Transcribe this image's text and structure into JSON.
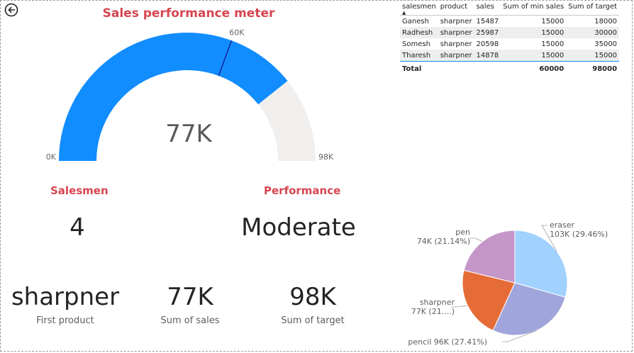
{
  "gauge": {
    "title": "Sales performance meter",
    "value": 77000,
    "value_label": "77K",
    "min": 0,
    "min_label": "0K",
    "max": 98000,
    "max_label": "98K",
    "target": 60000,
    "target_label": "60K",
    "fill_color": "#118dff",
    "track_color": "#f0efee",
    "target_color": "#12239e"
  },
  "cards": {
    "salesmen_title": "Salesmen",
    "salesmen_value": "4",
    "performance_title": "Performance",
    "performance_value": "Moderate",
    "first_product_value": "sharpner",
    "first_product_label": "First product",
    "sum_sales_value": "77K",
    "sum_sales_label": "Sum of sales",
    "sum_target_value": "98K",
    "sum_target_label": "Sum of target"
  },
  "table": {
    "headers": [
      "salesmen",
      "product",
      "sales",
      "Sum of min sales",
      "Sum of target"
    ],
    "rows": [
      [
        "Ganesh",
        "sharpner",
        "15487",
        "15000",
        "18000"
      ],
      [
        "Radhesh",
        "sharpner",
        "25987",
        "15000",
        "30000"
      ],
      [
        "Somesh",
        "sharpner",
        "20598",
        "15000",
        "35000"
      ],
      [
        "Tharesh",
        "sharpner",
        "14878",
        "15000",
        "15000"
      ]
    ],
    "total": [
      "Total",
      "",
      "",
      "60000",
      "98000"
    ]
  },
  "chart_data": {
    "type": "pie",
    "slices": [
      {
        "name": "eraser",
        "value": 103,
        "percent": 29.46,
        "label": "103K (29.46%)",
        "color": "#a0d1ff"
      },
      {
        "name": "pencil",
        "value": 96,
        "percent": 27.41,
        "label": "pencil 96K (27.41%)",
        "color": "#a0a6dc"
      },
      {
        "name": "sharpner",
        "value": 77,
        "percent": 21.99,
        "label": "77K (21....)",
        "color": "#e66c37"
      },
      {
        "name": "pen",
        "value": 74,
        "percent": 21.14,
        "label": "74K (21.14%)",
        "color": "#c597c9"
      }
    ]
  }
}
